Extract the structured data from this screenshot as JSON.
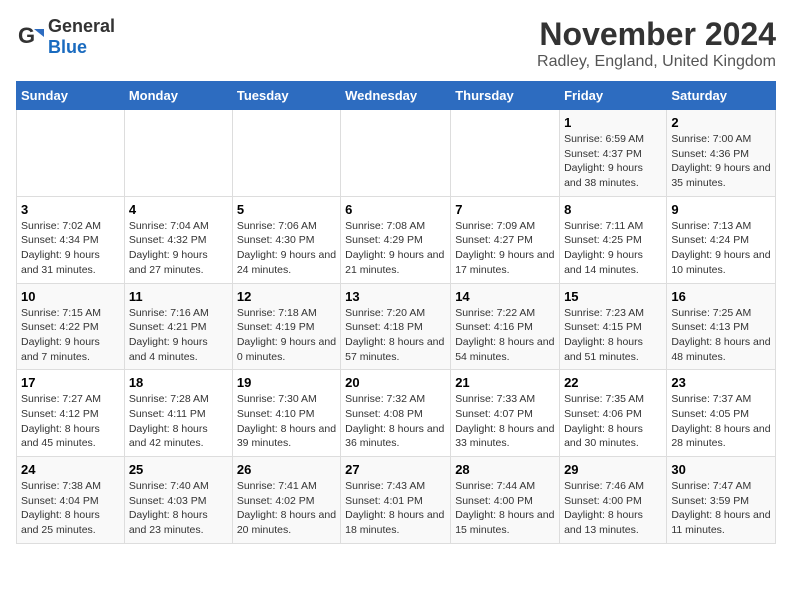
{
  "header": {
    "logo_general": "General",
    "logo_blue": "Blue",
    "month": "November 2024",
    "location": "Radley, England, United Kingdom"
  },
  "weekdays": [
    "Sunday",
    "Monday",
    "Tuesday",
    "Wednesday",
    "Thursday",
    "Friday",
    "Saturday"
  ],
  "weeks": [
    [
      {
        "day": "",
        "info": ""
      },
      {
        "day": "",
        "info": ""
      },
      {
        "day": "",
        "info": ""
      },
      {
        "day": "",
        "info": ""
      },
      {
        "day": "",
        "info": ""
      },
      {
        "day": "1",
        "info": "Sunrise: 6:59 AM\nSunset: 4:37 PM\nDaylight: 9 hours and 38 minutes."
      },
      {
        "day": "2",
        "info": "Sunrise: 7:00 AM\nSunset: 4:36 PM\nDaylight: 9 hours and 35 minutes."
      }
    ],
    [
      {
        "day": "3",
        "info": "Sunrise: 7:02 AM\nSunset: 4:34 PM\nDaylight: 9 hours and 31 minutes."
      },
      {
        "day": "4",
        "info": "Sunrise: 7:04 AM\nSunset: 4:32 PM\nDaylight: 9 hours and 27 minutes."
      },
      {
        "day": "5",
        "info": "Sunrise: 7:06 AM\nSunset: 4:30 PM\nDaylight: 9 hours and 24 minutes."
      },
      {
        "day": "6",
        "info": "Sunrise: 7:08 AM\nSunset: 4:29 PM\nDaylight: 9 hours and 21 minutes."
      },
      {
        "day": "7",
        "info": "Sunrise: 7:09 AM\nSunset: 4:27 PM\nDaylight: 9 hours and 17 minutes."
      },
      {
        "day": "8",
        "info": "Sunrise: 7:11 AM\nSunset: 4:25 PM\nDaylight: 9 hours and 14 minutes."
      },
      {
        "day": "9",
        "info": "Sunrise: 7:13 AM\nSunset: 4:24 PM\nDaylight: 9 hours and 10 minutes."
      }
    ],
    [
      {
        "day": "10",
        "info": "Sunrise: 7:15 AM\nSunset: 4:22 PM\nDaylight: 9 hours and 7 minutes."
      },
      {
        "day": "11",
        "info": "Sunrise: 7:16 AM\nSunset: 4:21 PM\nDaylight: 9 hours and 4 minutes."
      },
      {
        "day": "12",
        "info": "Sunrise: 7:18 AM\nSunset: 4:19 PM\nDaylight: 9 hours and 0 minutes."
      },
      {
        "day": "13",
        "info": "Sunrise: 7:20 AM\nSunset: 4:18 PM\nDaylight: 8 hours and 57 minutes."
      },
      {
        "day": "14",
        "info": "Sunrise: 7:22 AM\nSunset: 4:16 PM\nDaylight: 8 hours and 54 minutes."
      },
      {
        "day": "15",
        "info": "Sunrise: 7:23 AM\nSunset: 4:15 PM\nDaylight: 8 hours and 51 minutes."
      },
      {
        "day": "16",
        "info": "Sunrise: 7:25 AM\nSunset: 4:13 PM\nDaylight: 8 hours and 48 minutes."
      }
    ],
    [
      {
        "day": "17",
        "info": "Sunrise: 7:27 AM\nSunset: 4:12 PM\nDaylight: 8 hours and 45 minutes."
      },
      {
        "day": "18",
        "info": "Sunrise: 7:28 AM\nSunset: 4:11 PM\nDaylight: 8 hours and 42 minutes."
      },
      {
        "day": "19",
        "info": "Sunrise: 7:30 AM\nSunset: 4:10 PM\nDaylight: 8 hours and 39 minutes."
      },
      {
        "day": "20",
        "info": "Sunrise: 7:32 AM\nSunset: 4:08 PM\nDaylight: 8 hours and 36 minutes."
      },
      {
        "day": "21",
        "info": "Sunrise: 7:33 AM\nSunset: 4:07 PM\nDaylight: 8 hours and 33 minutes."
      },
      {
        "day": "22",
        "info": "Sunrise: 7:35 AM\nSunset: 4:06 PM\nDaylight: 8 hours and 30 minutes."
      },
      {
        "day": "23",
        "info": "Sunrise: 7:37 AM\nSunset: 4:05 PM\nDaylight: 8 hours and 28 minutes."
      }
    ],
    [
      {
        "day": "24",
        "info": "Sunrise: 7:38 AM\nSunset: 4:04 PM\nDaylight: 8 hours and 25 minutes."
      },
      {
        "day": "25",
        "info": "Sunrise: 7:40 AM\nSunset: 4:03 PM\nDaylight: 8 hours and 23 minutes."
      },
      {
        "day": "26",
        "info": "Sunrise: 7:41 AM\nSunset: 4:02 PM\nDaylight: 8 hours and 20 minutes."
      },
      {
        "day": "27",
        "info": "Sunrise: 7:43 AM\nSunset: 4:01 PM\nDaylight: 8 hours and 18 minutes."
      },
      {
        "day": "28",
        "info": "Sunrise: 7:44 AM\nSunset: 4:00 PM\nDaylight: 8 hours and 15 minutes."
      },
      {
        "day": "29",
        "info": "Sunrise: 7:46 AM\nSunset: 4:00 PM\nDaylight: 8 hours and 13 minutes."
      },
      {
        "day": "30",
        "info": "Sunrise: 7:47 AM\nSunset: 3:59 PM\nDaylight: 8 hours and 11 minutes."
      }
    ]
  ]
}
